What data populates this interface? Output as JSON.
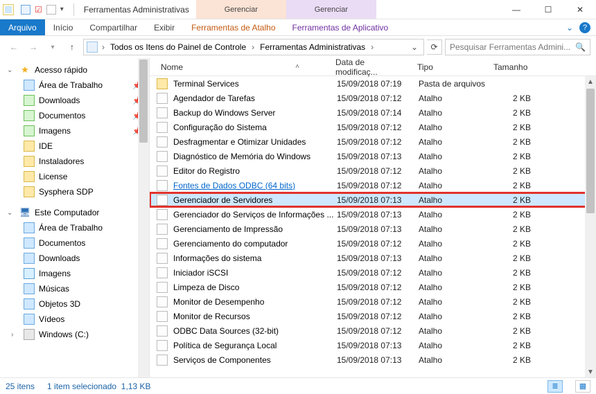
{
  "titlebar": {
    "app_title": "Ferramentas Administrativas",
    "manage1": "Gerenciar",
    "manage2": "Gerenciar"
  },
  "ribbon": {
    "file": "Arquivo",
    "home": "Início",
    "share": "Compartilhar",
    "view": "Exibir",
    "shortcut_tools": "Ferramentas de Atalho",
    "app_tools": "Ferramentas de Aplicativo"
  },
  "address": {
    "crumb1": "Todos os Itens do Painel de Controle",
    "crumb2": "Ferramentas Administrativas",
    "search_placeholder": "Pesquisar Ferramentas Admini..."
  },
  "columns": {
    "name": "Nome",
    "date": "Data de modificaç...",
    "type": "Tipo",
    "size": "Tamanho"
  },
  "tree": {
    "quick": "Acesso rápido",
    "quick_items": [
      {
        "label": "Área de Trabalho",
        "pin": true
      },
      {
        "label": "Downloads",
        "pin": true
      },
      {
        "label": "Documentos",
        "pin": true
      },
      {
        "label": "Imagens",
        "pin": true
      },
      {
        "label": "IDE",
        "pin": false
      },
      {
        "label": "Instaladores",
        "pin": false
      },
      {
        "label": "License",
        "pin": false
      },
      {
        "label": "Sysphera SDP",
        "pin": false
      }
    ],
    "this_pc": "Este Computador",
    "pc_items": [
      {
        "label": "Área de Trabalho"
      },
      {
        "label": "Documentos"
      },
      {
        "label": "Downloads"
      },
      {
        "label": "Imagens"
      },
      {
        "label": "Músicas"
      },
      {
        "label": "Objetos 3D"
      },
      {
        "label": "Vídeos"
      },
      {
        "label": "Windows (C:)"
      }
    ]
  },
  "rows": [
    {
      "name": "Terminal Services",
      "date": "15/09/2018 07:19",
      "type": "Pasta de arquivos",
      "size": "",
      "folder": true
    },
    {
      "name": "Agendador de Tarefas",
      "date": "15/09/2018 07:12",
      "type": "Atalho",
      "size": "2 KB"
    },
    {
      "name": "Backup do Windows Server",
      "date": "15/09/2018 07:14",
      "type": "Atalho",
      "size": "2 KB"
    },
    {
      "name": "Configuração do Sistema",
      "date": "15/09/2018 07:12",
      "type": "Atalho",
      "size": "2 KB"
    },
    {
      "name": "Desfragmentar e Otimizar Unidades",
      "date": "15/09/2018 07:12",
      "type": "Atalho",
      "size": "2 KB"
    },
    {
      "name": "Diagnóstico de Memória do Windows",
      "date": "15/09/2018 07:13",
      "type": "Atalho",
      "size": "2 KB"
    },
    {
      "name": "Editor do Registro",
      "date": "15/09/2018 07:12",
      "type": "Atalho",
      "size": "2 KB"
    },
    {
      "name": "Fontes de Dados ODBC (64 bits)",
      "date": "15/09/2018 07:12",
      "type": "Atalho",
      "size": "2 KB",
      "link": true
    },
    {
      "name": "Gerenciador de Servidores",
      "date": "15/09/2018 07:13",
      "type": "Atalho",
      "size": "2 KB",
      "selected": true,
      "highlight": true
    },
    {
      "name": "Gerenciador do Serviços de Informações ...",
      "date": "15/09/2018 07:13",
      "type": "Atalho",
      "size": "2 KB"
    },
    {
      "name": "Gerenciamento de Impressão",
      "date": "15/09/2018 07:13",
      "type": "Atalho",
      "size": "2 KB"
    },
    {
      "name": "Gerenciamento do computador",
      "date": "15/09/2018 07:12",
      "type": "Atalho",
      "size": "2 KB"
    },
    {
      "name": "Informações do sistema",
      "date": "15/09/2018 07:13",
      "type": "Atalho",
      "size": "2 KB"
    },
    {
      "name": "Iniciador iSCSI",
      "date": "15/09/2018 07:12",
      "type": "Atalho",
      "size": "2 KB"
    },
    {
      "name": "Limpeza de Disco",
      "date": "15/09/2018 07:12",
      "type": "Atalho",
      "size": "2 KB"
    },
    {
      "name": "Monitor de Desempenho",
      "date": "15/09/2018 07:12",
      "type": "Atalho",
      "size": "2 KB"
    },
    {
      "name": "Monitor de Recursos",
      "date": "15/09/2018 07:12",
      "type": "Atalho",
      "size": "2 KB"
    },
    {
      "name": "ODBC Data Sources (32-bit)",
      "date": "15/09/2018 07:12",
      "type": "Atalho",
      "size": "2 KB"
    },
    {
      "name": "Política de Segurança Local",
      "date": "15/09/2018 07:13",
      "type": "Atalho",
      "size": "2 KB"
    },
    {
      "name": "Serviços de Componentes",
      "date": "15/09/2018 07:13",
      "type": "Atalho",
      "size": "2 KB"
    }
  ],
  "status": {
    "count": "25 itens",
    "selection": "1 item selecionado",
    "size": "1,13 KB"
  }
}
